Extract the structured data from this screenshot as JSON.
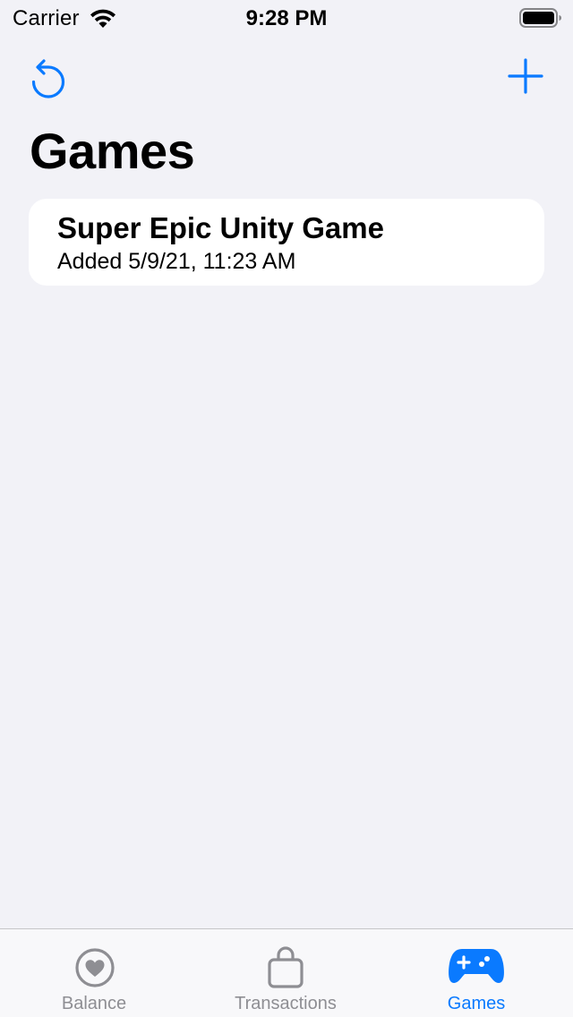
{
  "status_bar": {
    "carrier": "Carrier",
    "time": "9:28 PM"
  },
  "nav": {
    "left_icon": "refresh-icon",
    "right_icon": "plus-icon"
  },
  "page": {
    "title": "Games"
  },
  "games": [
    {
      "name": "Super Epic Unity Game",
      "added": "Added 5/9/21, 11:23 AM"
    }
  ],
  "tab_bar": {
    "items": [
      {
        "label": "Balance",
        "icon": "heart-circle-icon",
        "active": false
      },
      {
        "label": "Transactions",
        "icon": "bag-icon",
        "active": false
      },
      {
        "label": "Games",
        "icon": "gamecontroller-icon",
        "active": true
      }
    ]
  },
  "colors": {
    "accent": "#0a7aff",
    "background": "#f2f2f7",
    "inactive_tab": "#8e8e93",
    "card": "#ffffff"
  }
}
